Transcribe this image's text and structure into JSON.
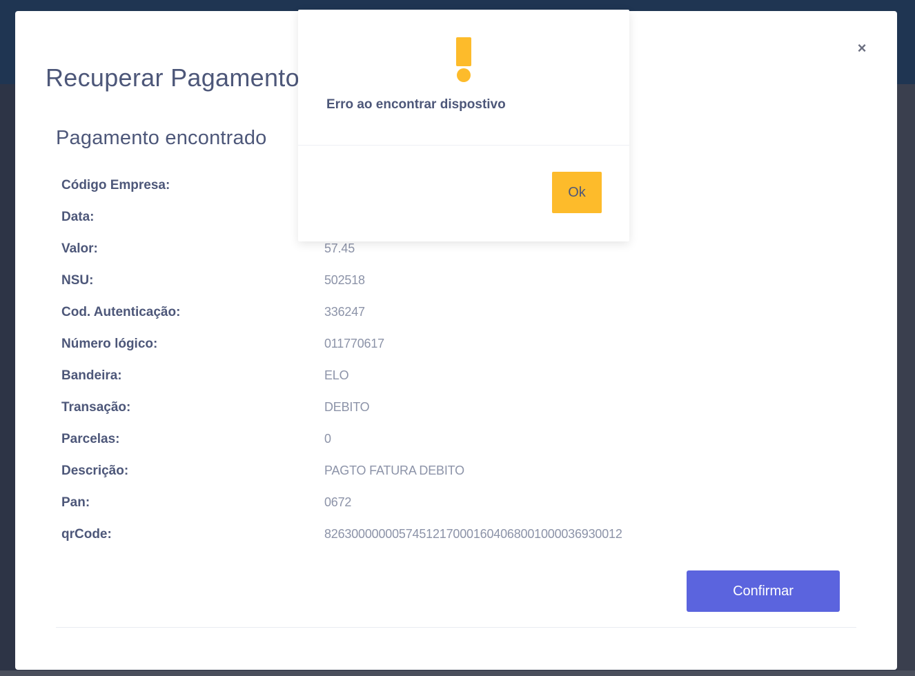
{
  "modal": {
    "title": "Recuperar Pagamento",
    "close_label": "×",
    "section_title": "Pagamento encontrado",
    "confirm_label": "Confirmar"
  },
  "details": [
    {
      "label": "Código Empresa:",
      "value": ""
    },
    {
      "label": "Data:",
      "value": ""
    },
    {
      "label": "Valor:",
      "value": "57.45"
    },
    {
      "label": "NSU:",
      "value": "502518"
    },
    {
      "label": "Cod. Autenticação:",
      "value": "336247"
    },
    {
      "label": "Número lógico:",
      "value": "011770617"
    },
    {
      "label": "Bandeira:",
      "value": "ELO"
    },
    {
      "label": "Transação:",
      "value": "DEBITO"
    },
    {
      "label": "Parcelas:",
      "value": "0"
    },
    {
      "label": "Descrição:",
      "value": "PAGTO FATURA DEBITO"
    },
    {
      "label": "Pan:",
      "value": "0672"
    },
    {
      "label": "qrCode:",
      "value": "82630000000574512170001604068001000036930012"
    }
  ],
  "alert": {
    "icon": "warning-exclamation-icon",
    "message": "Erro ao encontrar dispostivo",
    "ok_label": "Ok",
    "icon_color": "#fdbb2b"
  },
  "colors": {
    "primary": "#5b64de",
    "warning": "#fdbb2b",
    "text": "#4d5779",
    "muted": "#8c93a8"
  }
}
